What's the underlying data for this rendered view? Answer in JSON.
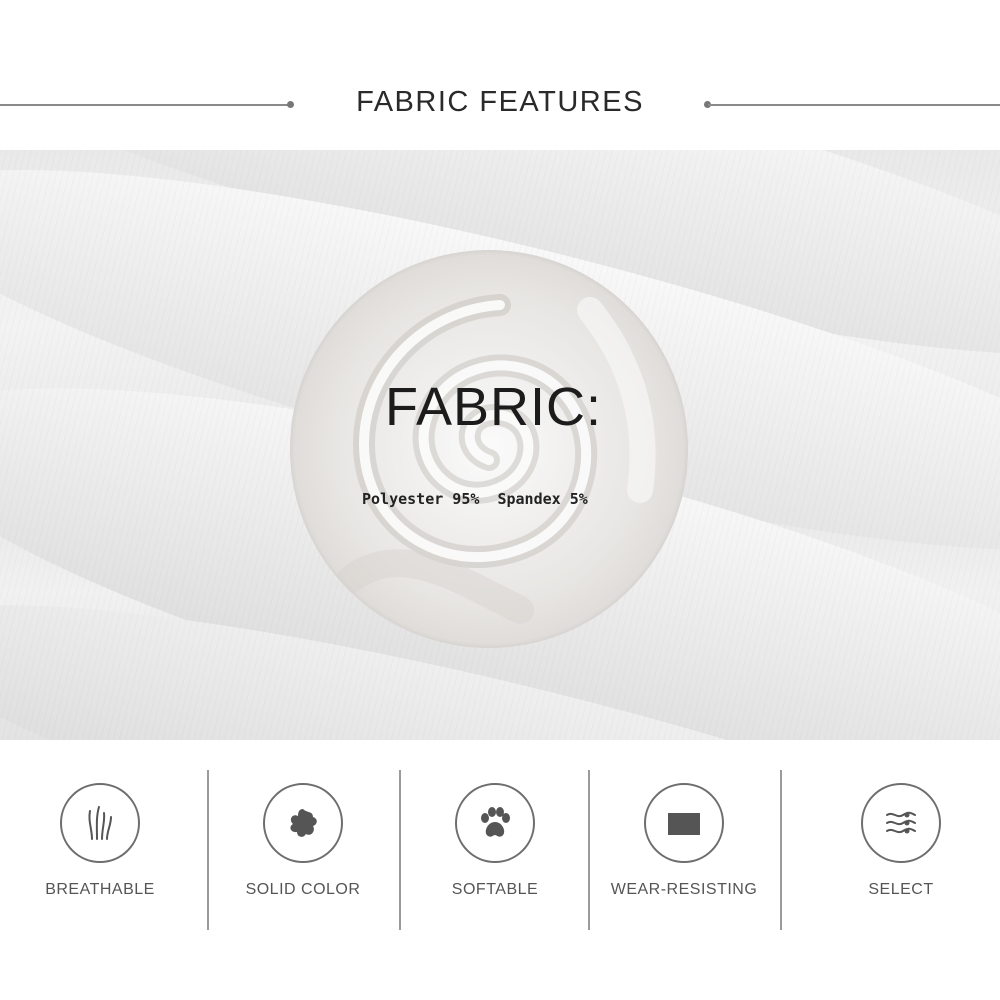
{
  "header": {
    "title": "FABRIC FEATURES"
  },
  "fabric": {
    "title": "FABRIC:",
    "composition": "Polyester 95%  Spandex 5%"
  },
  "features": [
    {
      "label": "BREATHABLE",
      "icon": "grass-icon"
    },
    {
      "label": "SOLID COLOR",
      "icon": "paint-splash-icon"
    },
    {
      "label": "SOFTABLE",
      "icon": "paw-icon"
    },
    {
      "label": "WEAR-RESISTING",
      "icon": "fabric-swatch-icon"
    },
    {
      "label": "SELECT",
      "icon": "threads-icon"
    }
  ]
}
